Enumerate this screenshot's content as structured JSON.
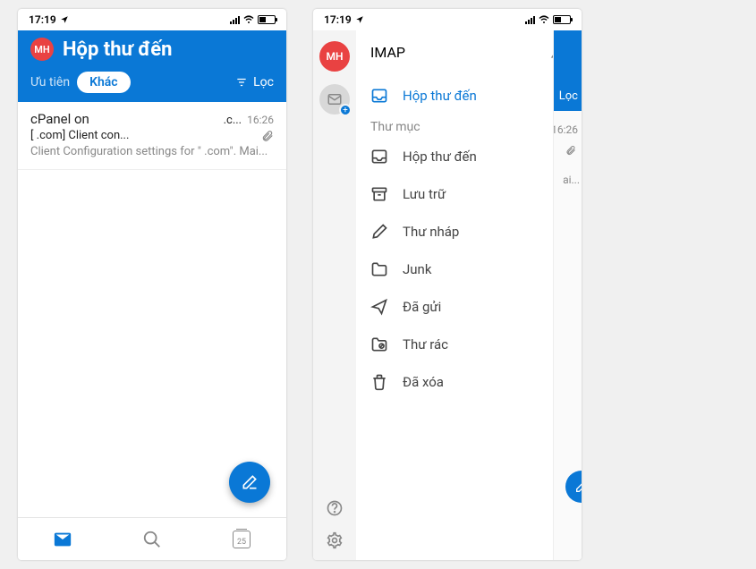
{
  "status": {
    "time": "17:19",
    "location_icon": "location-arrow",
    "signal": 4,
    "wifi": true,
    "battery_pct": 40
  },
  "colors": {
    "primary": "#0a78d6",
    "avatar_bg": "#e94242"
  },
  "avatar_initials": "MH",
  "screen1": {
    "title": "Hộp thư đến",
    "tabs": {
      "priority": "Ưu tiên",
      "other": "Khác",
      "active": "other"
    },
    "filter_label": "Lọc",
    "email": {
      "sender": "cPanel on",
      "domain": ".c...",
      "time": "16:26",
      "subject": "[                         .com] Client con...",
      "has_attachment": true,
      "preview": "Client Configuration settings for \"                            .com\". Mai..."
    },
    "fab": "compose",
    "nav": {
      "mail": "mail",
      "search": "search",
      "calendar_day": "25"
    }
  },
  "screen2": {
    "account_label": "IMAP",
    "notifications_icon": "bell",
    "selected_folder": "Hộp thư đến",
    "section_label": "Thư mục",
    "folders": [
      {
        "icon": "inbox",
        "label": "Hộp thư đến"
      },
      {
        "icon": "archive",
        "label": "Lưu trữ"
      },
      {
        "icon": "drafts",
        "label": "Thư nháp"
      },
      {
        "icon": "folder",
        "label": "Junk"
      },
      {
        "icon": "sent",
        "label": "Đã gửi"
      },
      {
        "icon": "spam",
        "label": "Thư rác"
      },
      {
        "icon": "trash",
        "label": "Đã xóa"
      }
    ],
    "rail_bottom": {
      "help": "help",
      "settings": "settings"
    },
    "peek": {
      "filter_label": "Lọc",
      "time": "16:26",
      "preview_tail": "ai..."
    }
  }
}
